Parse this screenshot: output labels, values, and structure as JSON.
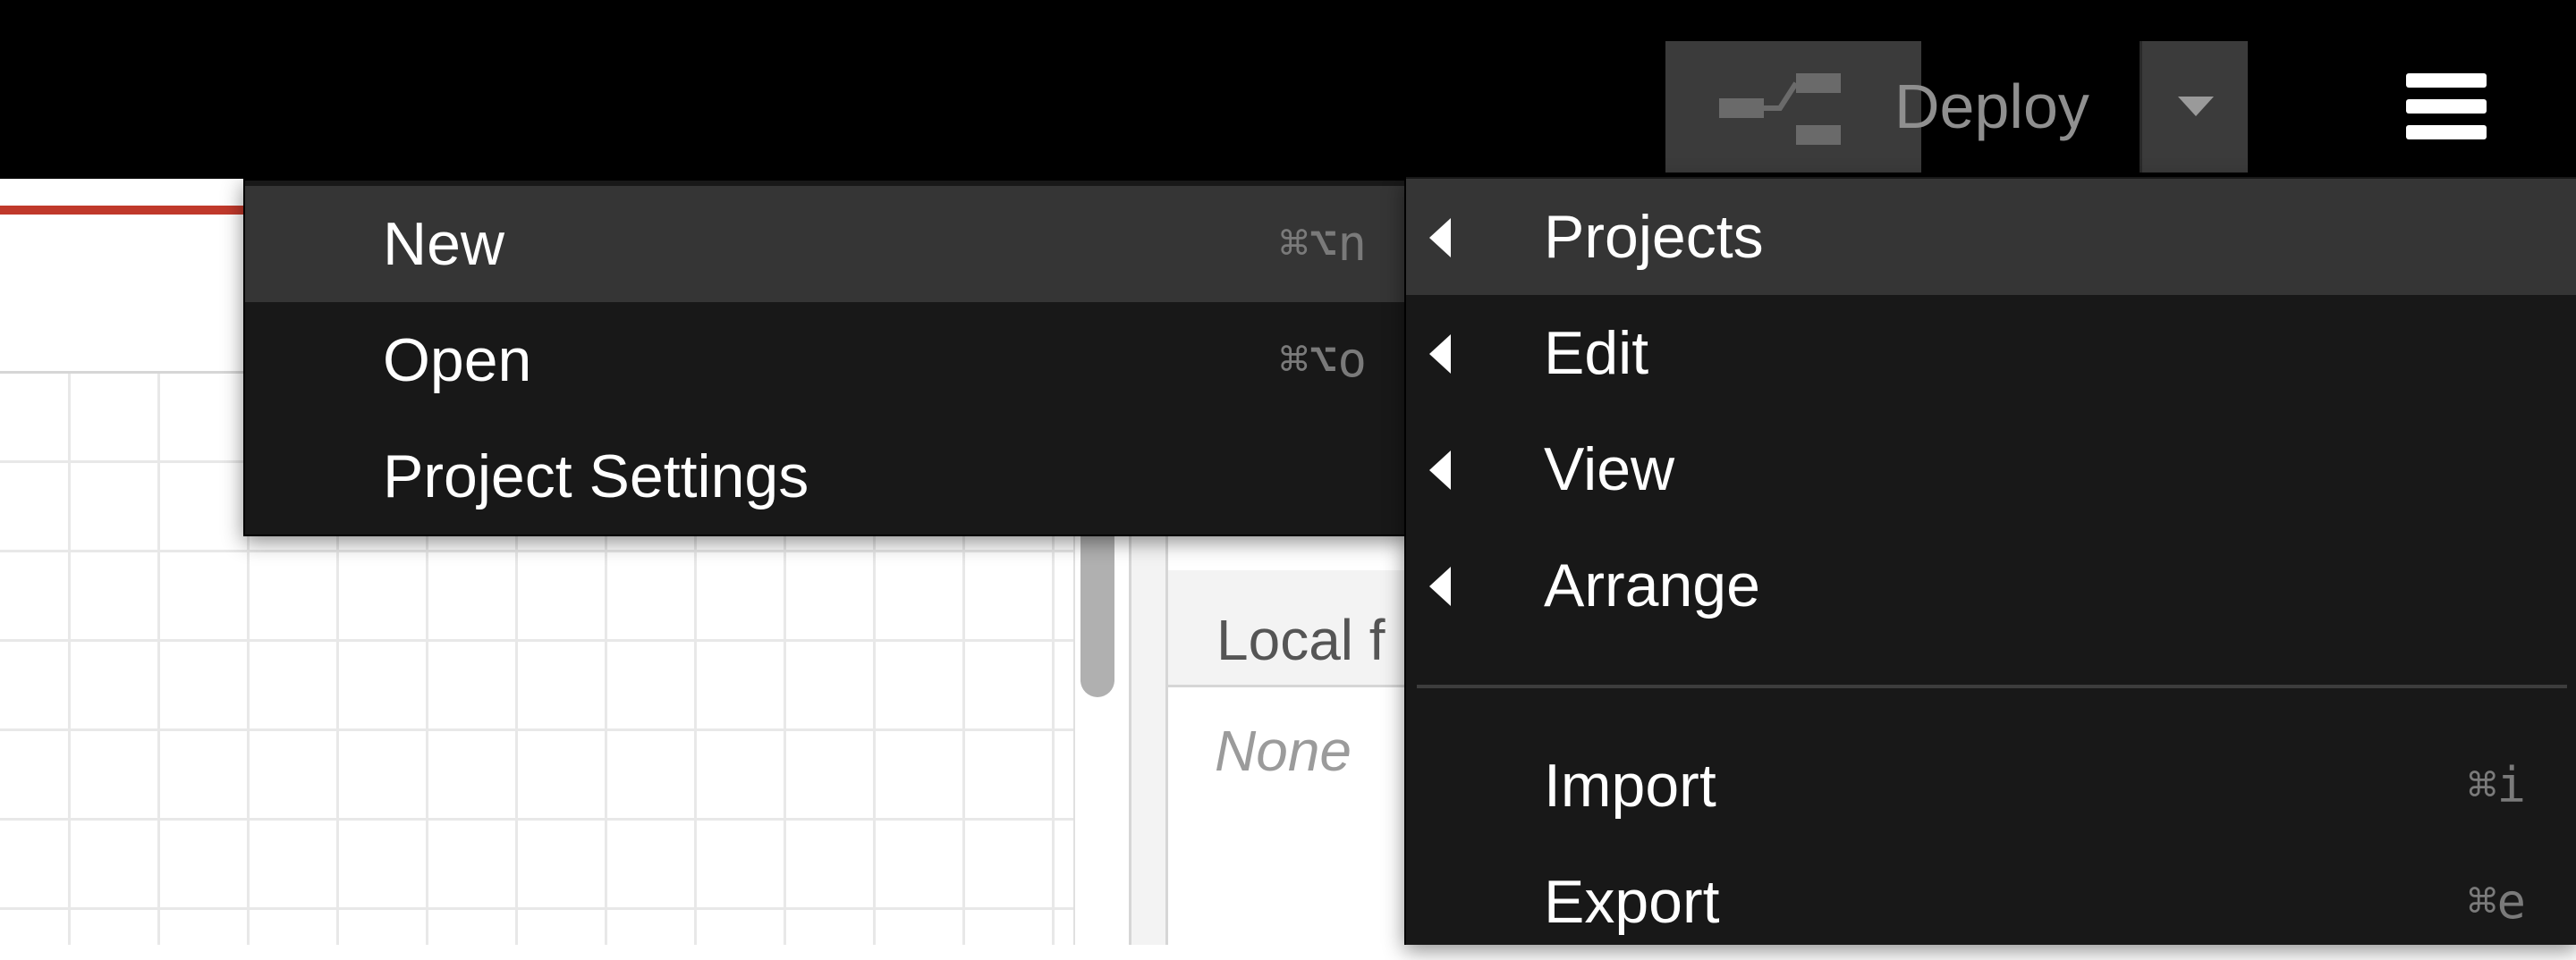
{
  "header": {
    "deploy_label": "Deploy"
  },
  "sidebar": {
    "header_text": "Local f",
    "empty_text": "None"
  },
  "submenu": {
    "items": [
      {
        "label": "New",
        "shortcut": "⌘⌥n",
        "active": true
      },
      {
        "label": "Open",
        "shortcut": "⌘⌥o"
      },
      {
        "label": "Project Settings",
        "shortcut": ""
      }
    ]
  },
  "main_menu": {
    "items": [
      {
        "label": "Projects",
        "has_submenu": true,
        "active": true
      },
      {
        "label": "Edit",
        "has_submenu": true
      },
      {
        "label": "View",
        "has_submenu": true
      },
      {
        "label": "Arrange",
        "has_submenu": true
      },
      {
        "label": "Import",
        "shortcut": "⌘i"
      },
      {
        "label": "Export",
        "shortcut": "⌘e"
      }
    ]
  },
  "colors": {
    "header_bg": "#000000",
    "menu_bg": "#181818",
    "menu_active_bg": "#353535",
    "accent_red": "#c0392b"
  }
}
